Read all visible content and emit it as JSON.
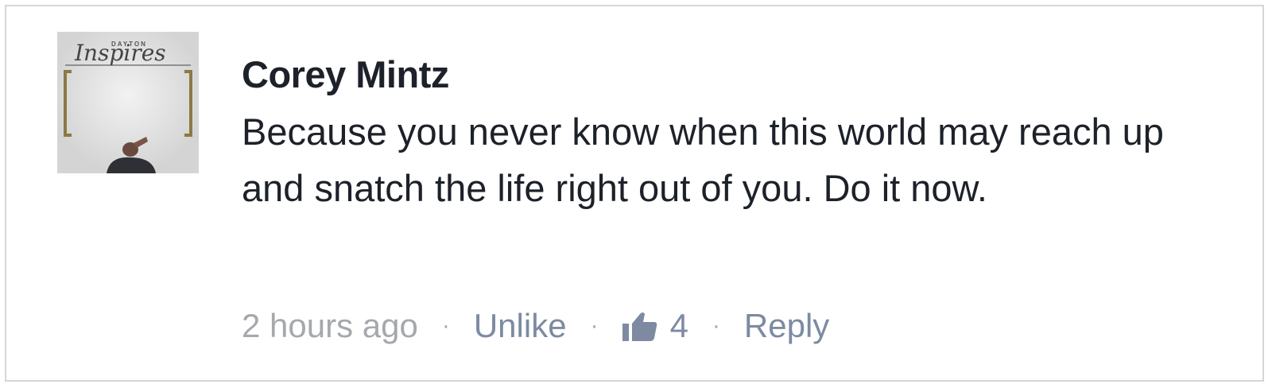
{
  "comment": {
    "author": "Corey Mintz",
    "text": "Because you never know when this world may reach up and snatch the life right out of you. Do it now.",
    "timestamp": "2 hours ago",
    "separator": "·",
    "actions": {
      "unlike_label": "Unlike",
      "like_count": "4",
      "reply_label": "Reply"
    },
    "avatar": {
      "logo_small_text": "DAYTON",
      "logo_script_text": "Inspires"
    }
  },
  "icons": {
    "like": "thumbs-up-icon"
  },
  "colors": {
    "author_text": "#1d2129",
    "body_text": "#1d2129",
    "meta_gray": "#a5a8ad",
    "action_link": "#7d8aa2",
    "card_border": "#d6d6d6"
  }
}
